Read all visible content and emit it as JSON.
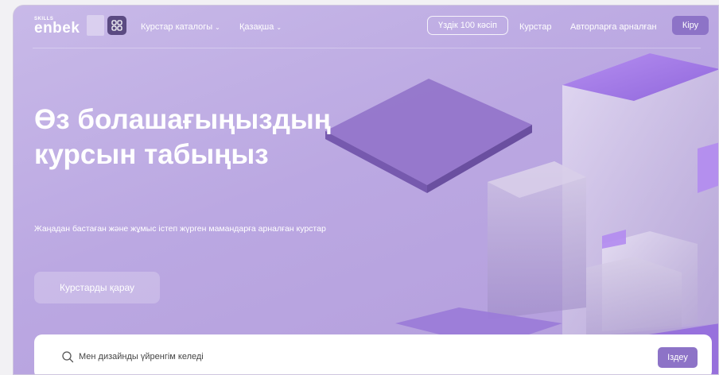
{
  "header": {
    "logo_small": "SKILLS",
    "logo_main": "enbek",
    "nav": {
      "catalog": "Курстар каталогы",
      "language": "Қазақша",
      "top_professions": "Үздік 100 кәсіп",
      "courses": "Курстар",
      "for_authors": "Авторларға арналған",
      "login": "Кіру"
    }
  },
  "hero": {
    "title": "Өз болашағыңыздың курсын табыңыз",
    "subtitle": "Жаңадан бастаған және жұмыс істеп жүрген мамандарға арналған курстар",
    "cta": "Курстарды қарау"
  },
  "search": {
    "placeholder": "Мен дизайнды үйренгім келеді",
    "button": "Іздеу"
  },
  "colors": {
    "hero_bg": "#bba8e2",
    "accent": "#8d73c7",
    "apps_button": "#5b4a82"
  }
}
